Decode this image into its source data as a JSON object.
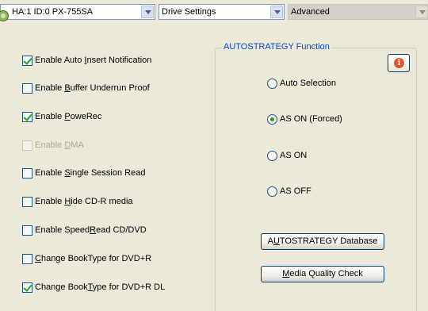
{
  "toolbar": {
    "drive": {
      "value": "HA:1 ID:0  PX-755SA",
      "icon": "cd-drive-icon"
    },
    "settings": {
      "value": "Drive Settings"
    },
    "mode": {
      "value": "Advanced",
      "disabled": true
    }
  },
  "options": [
    {
      "pre": "Enable Auto ",
      "u": "I",
      "post": "nsert Notification",
      "checked": true,
      "disabled": false
    },
    {
      "pre": "Enable ",
      "u": "B",
      "post": "uffer Underrun Proof",
      "checked": false,
      "disabled": false
    },
    {
      "pre": "Enable ",
      "u": "P",
      "post": "oweRec",
      "checked": true,
      "disabled": false
    },
    {
      "pre": "Enable ",
      "u": "D",
      "post": "MA",
      "checked": false,
      "disabled": true
    },
    {
      "pre": "Enable ",
      "u": "S",
      "post": "ingle Session Read",
      "checked": false,
      "disabled": false
    },
    {
      "pre": "Enable ",
      "u": "H",
      "post": "ide CD-R media",
      "checked": false,
      "disabled": false
    },
    {
      "pre": "Enable Speed",
      "u": "R",
      "post": "ead CD/DVD",
      "checked": false,
      "disabled": false
    },
    {
      "pre": "",
      "u": "C",
      "post": "hange BookType for DVD+R",
      "checked": false,
      "disabled": false
    },
    {
      "pre": "Change Book",
      "u": "T",
      "post": "ype for DVD+R DL",
      "checked": true,
      "disabled": false
    }
  ],
  "autostrategy": {
    "title": "AUTOSTRATEGY Function",
    "info_icon": "info-icon",
    "radios": [
      {
        "label": "Auto Selection",
        "checked": false
      },
      {
        "label": "AS ON (Forced)",
        "checked": true
      },
      {
        "label": "AS ON",
        "checked": false
      },
      {
        "label": "AS OFF",
        "checked": false
      }
    ],
    "db_button": {
      "pre": "A",
      "u": "U",
      "post": "TOSTRATEGY Database"
    },
    "mqc_button": {
      "pre": "",
      "u": "M",
      "post": "edia Quality Check"
    }
  },
  "colors": {
    "group_title": "#0046d5",
    "check": "#21a121",
    "bg": "#ece9d8"
  }
}
